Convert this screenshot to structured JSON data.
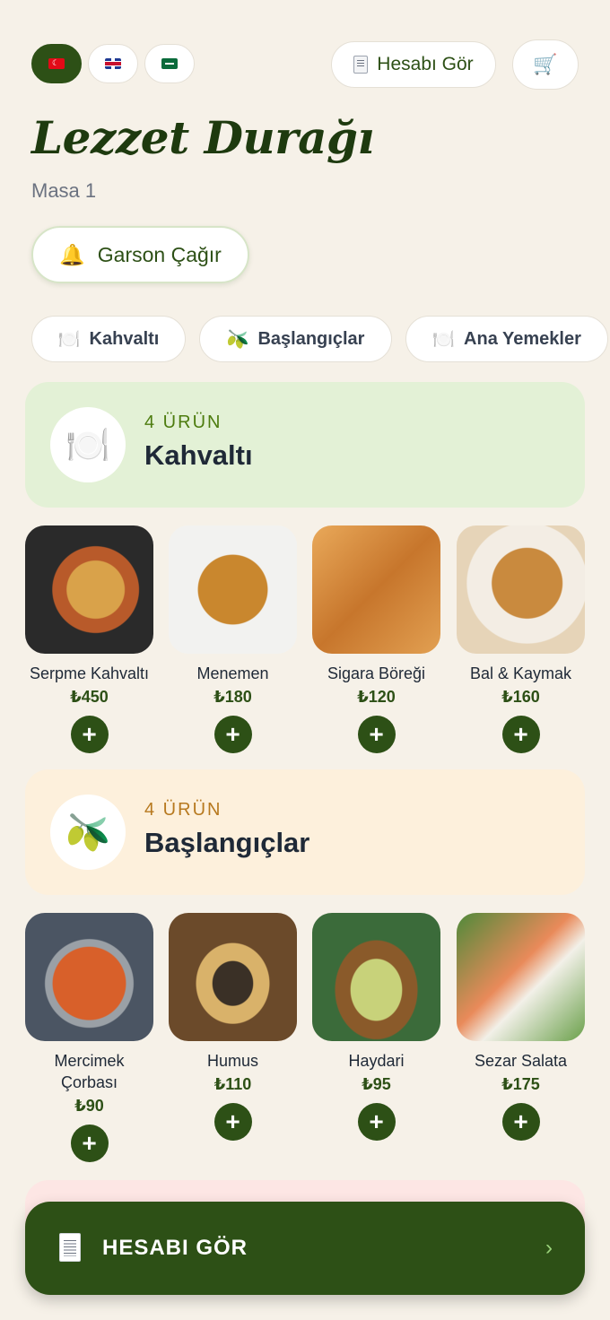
{
  "header": {
    "languages": [
      {
        "code": "tr",
        "active": true
      },
      {
        "code": "en",
        "active": false
      },
      {
        "code": "ar",
        "active": false
      }
    ],
    "bill_button": "Hesabı Gör",
    "cart_icon": "🛒"
  },
  "restaurant": {
    "name": "Lezzet Durağı",
    "table": "Masa 1",
    "call_waiter": "Garson Çağır",
    "call_waiter_icon": "🔔"
  },
  "categories": [
    {
      "icon": "🍽️",
      "label": "Kahvaltı"
    },
    {
      "icon": "🫒",
      "label": "Başlangıçlar"
    },
    {
      "icon": "🍽️",
      "label": "Ana Yemekler"
    }
  ],
  "sections": [
    {
      "icon": "🍽️",
      "count": "4 ÜRÜN",
      "name": "Kahvaltı",
      "bg": "#e3f1d6",
      "count_color": "#4d7c0f",
      "items": [
        {
          "name": "Serpme Kahvaltı",
          "price": "₺450"
        },
        {
          "name": "Menemen",
          "price": "₺180"
        },
        {
          "name": "Sigara Böreği",
          "price": "₺120"
        },
        {
          "name": "Bal & Kaymak",
          "price": "₺160"
        }
      ]
    },
    {
      "icon": "🫒",
      "count": "4 ÜRÜN",
      "name": "Başlangıçlar",
      "bg": "#fdf0dc",
      "count_color": "#b7791f",
      "items": [
        {
          "name": "Mercimek Çorbası",
          "price": "₺90"
        },
        {
          "name": "Humus",
          "price": "₺110"
        },
        {
          "name": "Haydari",
          "price": "₺95"
        },
        {
          "name": "Sezar Salata",
          "price": "₺175"
        }
      ]
    }
  ],
  "add_label": "+",
  "bottom_bar": {
    "label": "HESABI GÖR",
    "chevron": "›"
  },
  "colors": {
    "primary": "#2d5016",
    "background": "#f6f1e8"
  }
}
